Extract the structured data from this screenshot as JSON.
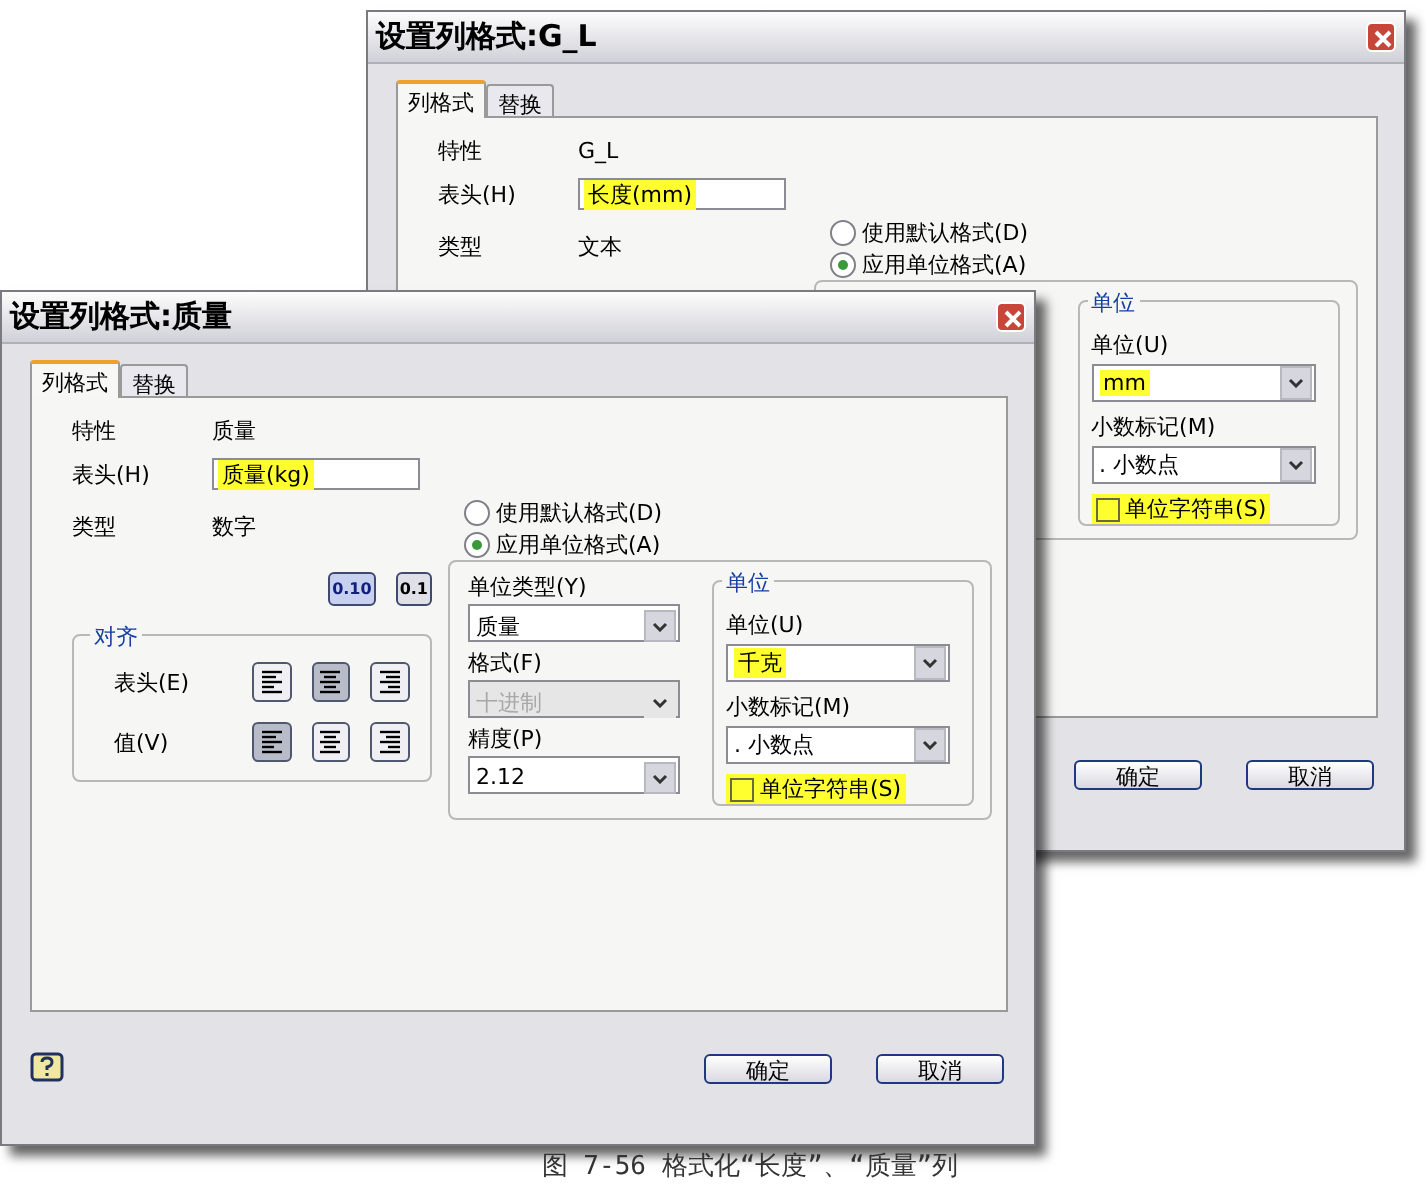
{
  "dialogs": [
    {
      "title": "设置列格式:G_L",
      "tabs": [
        {
          "label": "列格式",
          "selected": true
        },
        {
          "label": "替换",
          "selected": false
        }
      ],
      "property": {
        "label": "特性",
        "value": "G_L"
      },
      "header": {
        "label": "表头(H)",
        "value": "长度(mm)",
        "highlighted": true
      },
      "type": {
        "label": "类型",
        "value": "文本"
      },
      "format_options": [
        {
          "label": "使用默认格式(D)",
          "selected": false
        },
        {
          "label": "应用单位格式(A)",
          "selected": true
        }
      ],
      "unit_group": {
        "legend": "单位",
        "fields": [
          {
            "label": "单位(U)",
            "value": "mm",
            "highlighted": true
          },
          {
            "label": "小数标记(M)",
            "value": ". 小数点",
            "highlighted": false
          }
        ],
        "checkbox": {
          "label": "单位字符串(S)",
          "checked": false,
          "highlighted": true
        }
      },
      "buttons": [
        "确定",
        "取消"
      ]
    },
    {
      "title": "设置列格式:质量",
      "tabs": [
        {
          "label": "列格式",
          "selected": true
        },
        {
          "label": "替换",
          "selected": false
        }
      ],
      "property": {
        "label": "特性",
        "value": "质量"
      },
      "header": {
        "label": "表头(H)",
        "value": "质量(kg)",
        "highlighted": true
      },
      "type": {
        "label": "类型",
        "value": "数字"
      },
      "precision_buttons": [
        {
          "label": "0.10",
          "selected": true
        },
        {
          "label": "0.1",
          "selected": false
        }
      ],
      "alignment": {
        "legend": "对齐",
        "rows": [
          {
            "label": "表头(E)",
            "options": [
              {
                "kind": "left",
                "selected": false
              },
              {
                "kind": "center",
                "selected": true
              },
              {
                "kind": "right",
                "selected": false
              }
            ]
          },
          {
            "label": "值(V)",
            "options": [
              {
                "kind": "left",
                "selected": true
              },
              {
                "kind": "center",
                "selected": false
              },
              {
                "kind": "right",
                "selected": false
              }
            ]
          }
        ]
      },
      "format_options": [
        {
          "label": "使用默认格式(D)",
          "selected": false
        },
        {
          "label": "应用单位格式(A)",
          "selected": true
        }
      ],
      "unit_fields": [
        {
          "label": "单位类型(Y)",
          "value": "质量",
          "disabled": false
        },
        {
          "label": "格式(F)",
          "value": "十进制",
          "disabled": true
        },
        {
          "label": "精度(P)",
          "value": "2.12",
          "disabled": false
        }
      ],
      "unit_group": {
        "legend": "单位",
        "fields": [
          {
            "label": "单位(U)",
            "value": "千克",
            "highlighted": true
          },
          {
            "label": "小数标记(M)",
            "value": ". 小数点",
            "highlighted": false
          }
        ],
        "checkbox": {
          "label": "单位字符串(S)",
          "checked": false,
          "highlighted": true
        }
      },
      "help_button": true,
      "buttons": [
        "确定",
        "取消"
      ]
    }
  ],
  "caption": "图 7-56 格式化“长度”、“质量”列"
}
